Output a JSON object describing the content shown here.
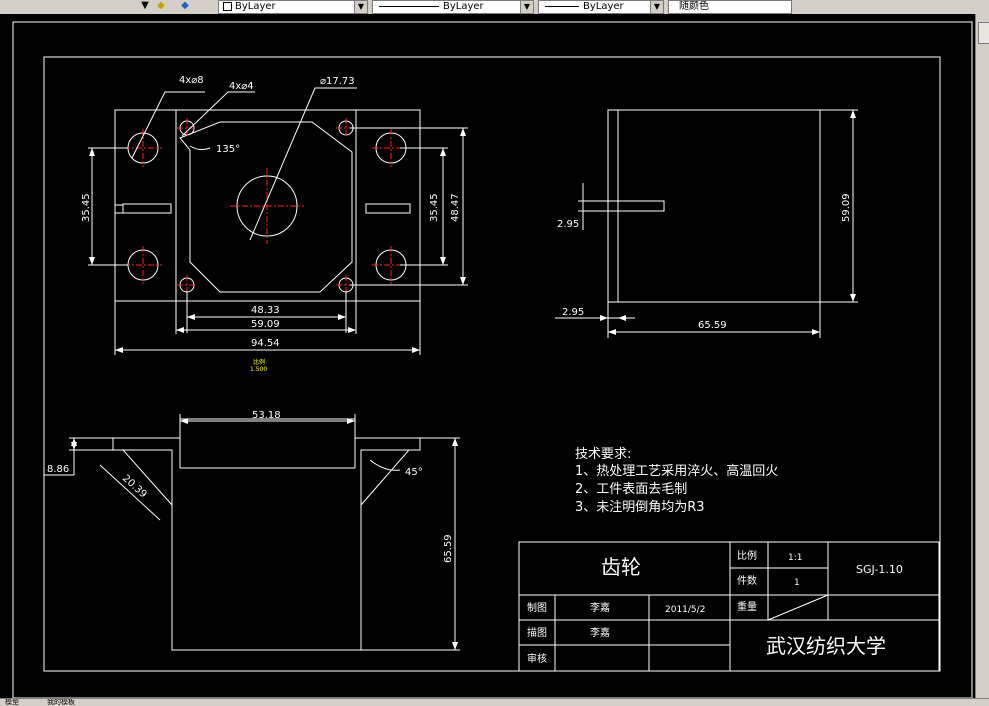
{
  "toolbar": {
    "layer_color": "ByLayer",
    "linetype": "ByLayer",
    "lineweight": "ByLayer",
    "plot_style": "随颜色"
  },
  "drawing": {
    "top_view": {
      "leader_holes8": "4x⌀8",
      "leader_holes4": "4x⌀4",
      "leader_center": "⌀17.73",
      "angle": "135°",
      "dim_left": "35.45",
      "dim_right_inner": "35.45",
      "dim_right_outer": "48.47",
      "dim_bottom_1": "48.33",
      "dim_bottom_2": "59.09",
      "dim_bottom_3": "94.54",
      "scale_label": "比例",
      "scale_value": "1.500"
    },
    "side_view": {
      "dim_slot": "2.95",
      "dim_height": "59.09",
      "dim_offset": "2.95",
      "dim_width": "65.59"
    },
    "front_view": {
      "dim_top": "53.18",
      "dim_flange": "8.86",
      "dim_chamfer": "20.39",
      "angle": "45°",
      "dim_height": "65.59"
    },
    "notes": {
      "title": "技术要求:",
      "line1": "1、热处理工艺采用淬火、高温回火",
      "line2": "2、工件表面去毛制",
      "line3": "3、未注明倒角均为R3"
    },
    "title_block": {
      "part_name": "齿轮",
      "scale_label": "比例",
      "scale_value": "1:1",
      "count_label": "件数",
      "count_value": "1",
      "weight_label": "重量",
      "drawing_no": "SGJ-1.10",
      "drawn_label": "制图",
      "drawn_name": "李嘉",
      "drawn_date": "2011/5/2",
      "traced_label": "描图",
      "traced_name": "李嘉",
      "checked_label": "审核",
      "school": "武汉纺织大学"
    }
  },
  "status": {
    "tab_model": "模型",
    "tab_layout": "我的模板"
  }
}
